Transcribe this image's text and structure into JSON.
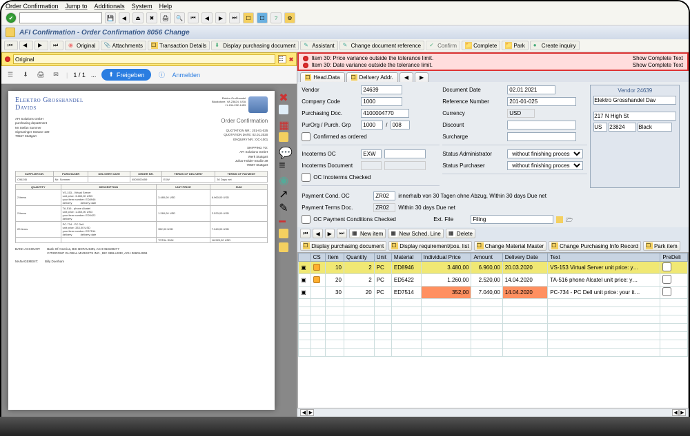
{
  "menu": {
    "oc": "Order Confirmation",
    "jump": "Jump to",
    "add": "Additionals",
    "sys": "System",
    "help": "Help"
  },
  "title": "AFI Confirmation - Order Confirmation 8056 Change",
  "toolbar2": {
    "original": "Original",
    "attachments": "Attachments",
    "trans": "Transaction Details",
    "disp": "Display purchasing document",
    "assist": "Assistant",
    "chg": "Change document reference",
    "confirm": "Confirm",
    "complete": "Complete",
    "park": "Park",
    "inquiry": "Create inquiry"
  },
  "yellowbar": {
    "value": "Original"
  },
  "pdf": {
    "page": "1 / 1",
    "div": "...",
    "freigeben": "Freigeben",
    "anmelden": "Anmelden"
  },
  "errors": {
    "e1": "Item 30: Price variance outside the tolerance limit.",
    "e2": "Item 30: Date variance outside the tolerance limit.",
    "show": "Show Complete Text"
  },
  "tabs": {
    "head": "Head.Data",
    "deliv": "Delivery Addr."
  },
  "form": {
    "vendor_l": "Vendor",
    "vendor": "24639",
    "company_l": "Company Code",
    "company": "1000",
    "purdoc_l": "Purchasing Doc.",
    "purdoc": "4100004770",
    "purorg_l": "PurOrg  /  Purch. Grp",
    "purorg": "1000",
    "purgrp": "008",
    "confirmed_l": "Confirmed as ordered",
    "docdate_l": "Document Date",
    "docdate": "02.01.2021",
    "ref_l": "Reference Number",
    "ref": "201-01-025",
    "curr_l": "Currency",
    "curr": "USD",
    "disc_l": "Discount",
    "surch_l": "Surcharge",
    "incoc_l": "Incoterms OC",
    "incoc": "EXW",
    "incod_l": "Incoterms Document",
    "incochk_l": "OC Incoterms Checked",
    "statadm_l": "Status Administrator",
    "statadm": "without finishing process",
    "statpur_l": "Status Purchaser",
    "statpur": "without finishing process",
    "payoc_l": "Payment Cond. OC",
    "payoc": "ZR02",
    "payoc_txt": "innerhalb von 30 Tagen ohne Abzug, Within 30 days Due net",
    "paydoc_l": "Payment Terms Doc.",
    "paydoc": "ZR02",
    "paydoc_txt": "Within 30 days Due net",
    "paychk_l": "OC Payment Conditions Checked",
    "ext_l": "Ext. File",
    "ext": "Filing"
  },
  "vendorbox": {
    "title": "Vendor 24639",
    "name": "Elektro Grosshandel Dav",
    "addr1": "217 N High St",
    "cc": "US",
    "zip": "23824",
    "city": "Black"
  },
  "itbar": {
    "newitem": "New item",
    "sched": "New Sched. Line",
    "del": "Delete",
    "disp": "Display purchasing document",
    "req": "Display requirement/pos. list",
    "mat": "Change Material Master",
    "rec": "Change Purchasing Info Record",
    "park": "Park item"
  },
  "gridhead": {
    "cs": "CS",
    "item": "Item",
    "qty": "Quantity",
    "unit": "Unit",
    "mat": "Material",
    "iprice": "Individual Price",
    "amount": "Amount",
    "ddate": "Delivery Date",
    "text": "Text",
    "pre": "PreDeli"
  },
  "rows": [
    {
      "item": "10",
      "qty": "2",
      "unit": "PC",
      "mat": "ED8946",
      "iprice": "3.480,00",
      "amount": "6.960,00",
      "ddate": "20.03.2020",
      "text": "VS-153 Virtual Server  unit price:  y…"
    },
    {
      "item": "20",
      "qty": "2",
      "unit": "PC",
      "mat": "ED5422",
      "iprice": "1.260,00",
      "amount": "2.520,00",
      "ddate": "14.04.2020",
      "text": "TA-516 phone Alcatel  unit price:  y…"
    },
    {
      "item": "30",
      "qty": "20",
      "unit": "PC",
      "mat": "ED7514",
      "iprice": "352,00",
      "amount": "7.040,00",
      "ddate": "14.04.2020",
      "text": "PC-734 - PC Dell  unit price:  your it…"
    }
  ],
  "doc": {
    "company1": "Elektro Großhandel",
    "company2": "Davids",
    "addr": "Elektro Großhandel\nBlackstone, VA 23824, USA\n+1 434-292-1459",
    "title": "Order Confirmation",
    "left": "AFI Solutions GmbH\npurchasing department\nMr Stefan Sommer\nSigmaringer Strasse 109\n70567 Stuttgart",
    "right": "QUOTATION NR.: 201-01-025\nQUOTATION DATE: 02.01.2020\nENQUIRY NR.: OC-1001",
    "ship_h": "SHIPPING TO:",
    "ship": "AFI Solutions GmbH\nWerk Stuttgart\nJulius-Hölder-Straße 39\n70597 Stuttgart",
    "th": [
      "SUPPLIER NR.",
      "PURCHASER",
      "DELIVERY DATE",
      "ORDER NR.",
      "TERMS OF DELIVERY",
      "TERMS OF PAYMENT"
    ],
    "tr1": [
      "C96245",
      "Mr. Sommer",
      "",
      "4500000459",
      "EXW",
      "30 Days net"
    ],
    "th2": [
      "QUANTITY",
      "DESCRIPTION",
      "UNIT PRICE",
      "SUM"
    ],
    "items": [
      {
        "qty": "2 items",
        "desc": "VS-153 - Virtual Server\nunit price: 3.480,00 USD\nyour item number: ED8946\ndelivery           delivery date",
        "up": "3.480,00 USD",
        "sum": "6.960,00 USD"
      },
      {
        "qty": "2 items",
        "desc": "TA-516 - phone Alcatel\nunit price: 1.260,00 USD\nyour item number: ED5422\ndelivery",
        "up": "1.260,00 USD",
        "sum": "2.520,00 USD"
      },
      {
        "qty": "20 items",
        "desc": "PC-734 - PC Dell\nunit price: 333,00 USD\nyour item number: ED7514\ndelivery           delivery date",
        "up": "352,00 USD",
        "sum": "7.040,00 USD"
      }
    ],
    "total_l": "TOTAL SUM",
    "total": "16.520,00 USD",
    "bank_l": "BANK ACCOUNT:",
    "bank": "Bank Of America, BIC BOFAUS3N, ACH 063100277\nCITIGROUP GLOBAL MARKETS INC., BIC SBILUS33, ACH 066014069",
    "mgr_l": "MANAGEMENT:",
    "mgr": "Billy Doerham"
  }
}
